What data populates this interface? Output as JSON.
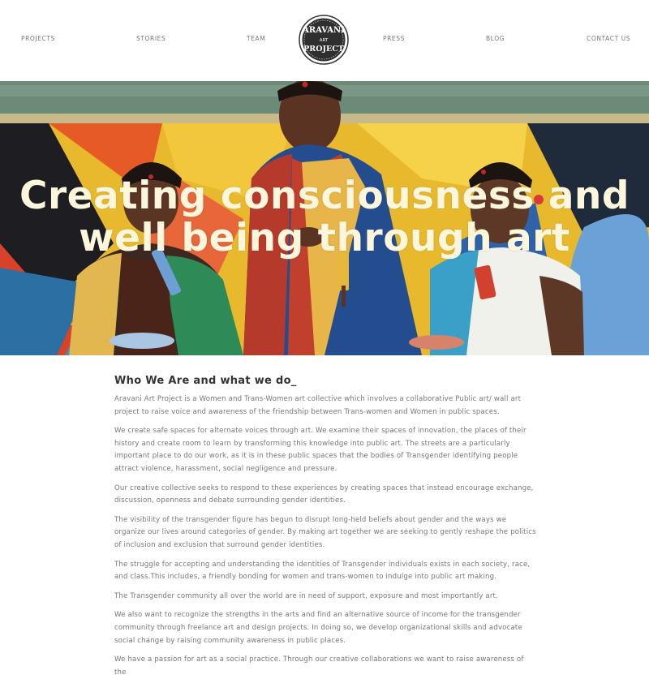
{
  "nav": {
    "projects": "PROJECTS",
    "stories": "STORIES",
    "team": "TEAM",
    "press": "PRESS",
    "blog": "BLOG",
    "contact": "CONTACT US"
  },
  "logo": {
    "line1": "ARAVANI",
    "line2": "ART",
    "line3": "PROJECT"
  },
  "hero": {
    "line1": "Creating consciousness and",
    "line2": "well being through art"
  },
  "about": {
    "heading": "Who We Are and what we do_",
    "paragraphs": [
      "Aravani Art Project is a Women and Trans-Women art collective which involves a collaborative Public art/ wall art project to raise voice and awareness of the friendship between Trans-women and Women in public spaces.",
      "We create safe spaces for alternate voices through art. We examine their spaces of innovation, the places of their history and create room to learn by transforming this knowledge into public art. The streets are a particularly important place to do our work, as it is in these public spaces that the bodies of Transgender identifying people attract violence, harassment, social negligence and pressure.",
      "Our creative collective seeks to respond to these experiences by creating spaces that instead encourage exchange, discussion, openness and debate surrounding gender identities.",
      "The visibility of the transgender figure has begun to disrupt long-held beliefs about gender and the ways we organize our lives around categories of gender. By making art together we are seeking to gently reshape the politics of inclusion and exclusion that surround gender identities.",
      "The struggle for accepting and understanding the identities of Transgender individuals exists in each society, race, and class.This includes, a friendly bonding for women and trans-women to indulge into public art making.",
      "The Transgender community all over the world are in need of support, exposure and most importantly art.",
      "We also want to recognize the strengths in the arts and find an alternative source of income for the transgender community through freelance art and design projects. In doing so, we develop organizational skills and advocate social change by raising community awareness in public places.",
      "We have a passion for art as a social practice. Through our creative collaborations we want to raise awareness of the"
    ]
  }
}
